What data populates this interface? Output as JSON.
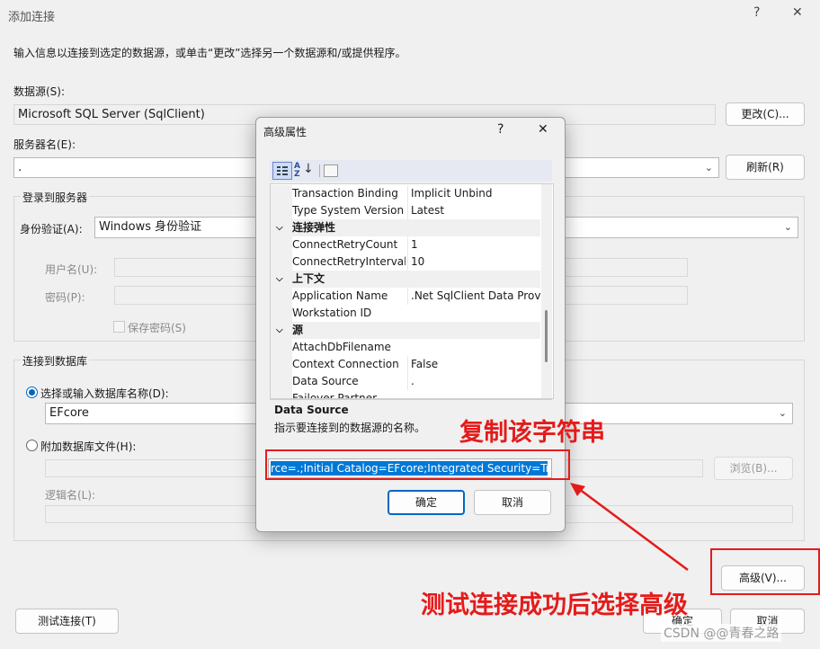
{
  "window": {
    "title": "添加连接",
    "help": "?",
    "close": "✕",
    "intro": "输入信息以连接到选定的数据源，或单击“更改”选择另一个数据源和/或提供程序。"
  },
  "datasource": {
    "label": "数据源(S):",
    "value": "Microsoft SQL Server (SqlClient)",
    "change_button": "更改(C)..."
  },
  "server": {
    "label": "服务器名(E):",
    "value": ".",
    "refresh_button": "刷新(R)"
  },
  "login": {
    "group_label": "登录到服务器",
    "auth_label": "身份验证(A):",
    "auth_value": "Windows 身份验证",
    "user_label": "用户名(U):",
    "password_label": "密码(P):",
    "save_password": "保存密码(S)"
  },
  "connect": {
    "group_label": "连接到数据库",
    "select_db_label": "选择或输入数据库名称(D):",
    "db_value": "EFcore",
    "attach_label": "附加数据库文件(H):",
    "browse_button": "浏览(B)...",
    "logical_name_label": "逻辑名(L):"
  },
  "advanced_button": "高级(V)...",
  "test_button": "测试连接(T)",
  "ok_button": "确定",
  "cancel_button": "取消",
  "watermark": "CSDN @@青春之路",
  "advanced_dialog": {
    "title": "高级属性",
    "help": "?",
    "close": "✕",
    "rows": [
      {
        "kind": "prop",
        "name": "Transaction Binding",
        "value": "Implicit Unbind"
      },
      {
        "kind": "prop",
        "name": "Type System Version",
        "value": "Latest"
      },
      {
        "kind": "cat",
        "name": "连接弹性",
        "value": ""
      },
      {
        "kind": "prop",
        "name": "ConnectRetryCount",
        "value": "1"
      },
      {
        "kind": "prop",
        "name": "ConnectRetryInterval",
        "value": "10"
      },
      {
        "kind": "cat",
        "name": "上下文",
        "value": ""
      },
      {
        "kind": "prop",
        "name": "Application Name",
        "value": ".Net SqlClient Data Provider"
      },
      {
        "kind": "prop",
        "name": "Workstation ID",
        "value": ""
      },
      {
        "kind": "cat",
        "name": "源",
        "value": ""
      },
      {
        "kind": "prop",
        "name": "AttachDbFilename",
        "value": ""
      },
      {
        "kind": "prop",
        "name": "Context Connection",
        "value": "False"
      },
      {
        "kind": "prop",
        "name": "Data Source",
        "value": "."
      },
      {
        "kind": "prop",
        "name": "Failover Partner",
        "value": ""
      }
    ],
    "desc_title": "Data Source",
    "desc_text": "指示要连接到的数据源的名称。",
    "connection_string": "rce=.;Initial Catalog=EFcore;Integrated Security=True",
    "ok_button": "确定",
    "cancel_button": "取消"
  },
  "annotations": {
    "copy_text": "复制该字符串",
    "advanced_text": "测试连接成功后选择高级",
    "color": "#e41b1b"
  }
}
